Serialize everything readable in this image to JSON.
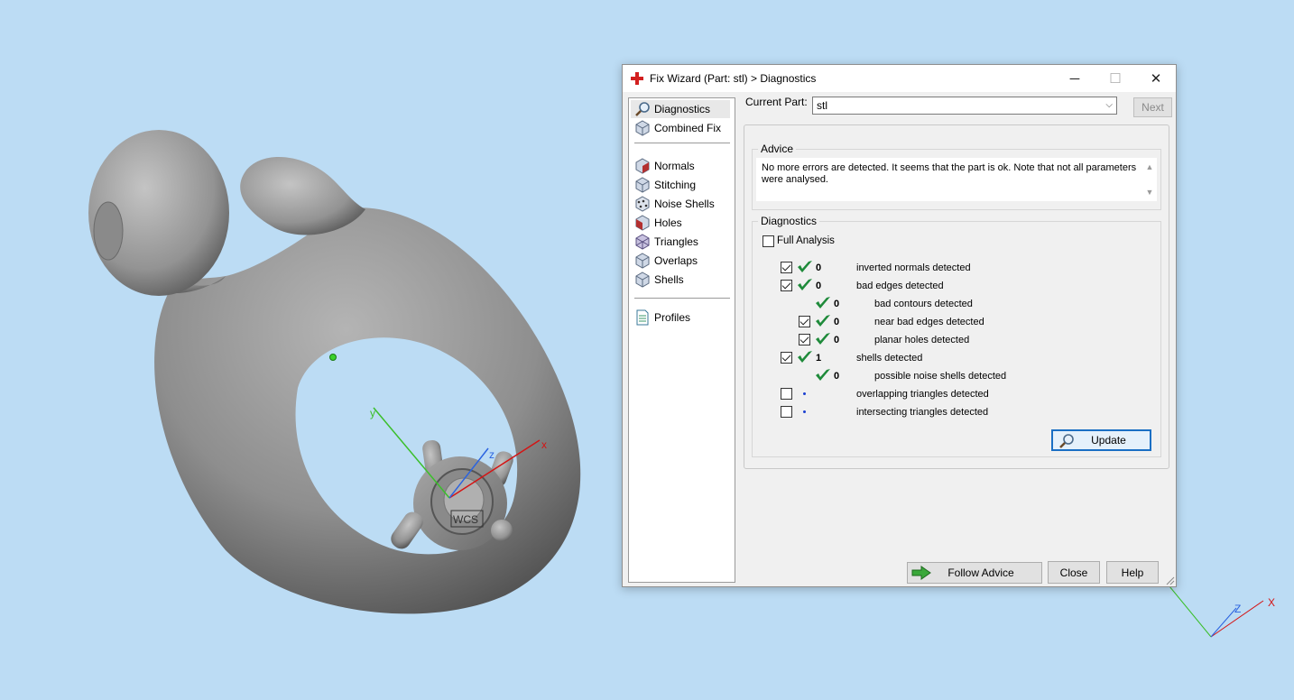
{
  "viewport": {
    "wcs_label": "WCS",
    "axis_x": "x",
    "axis_y": "y",
    "axis_z": "z",
    "mini_axis_x": "X",
    "mini_axis_z": "Z"
  },
  "dialog": {
    "title": "Fix Wizard (Part: stl) > Diagnostics",
    "window_buttons": {
      "minimize": "─",
      "maximize": "☐",
      "close": "✕"
    },
    "nav": {
      "items": [
        {
          "label": "Diagnostics",
          "icon": "magnifier-icon"
        },
        {
          "label": "Combined Fix",
          "icon": "cube-icon"
        },
        {
          "label": "Normals",
          "icon": "normals-cube-icon"
        },
        {
          "label": "Stitching",
          "icon": "stitching-cube-icon"
        },
        {
          "label": "Noise Shells",
          "icon": "noise-shells-icon"
        },
        {
          "label": "Holes",
          "icon": "holes-cube-icon"
        },
        {
          "label": "Triangles",
          "icon": "triangles-cube-icon"
        },
        {
          "label": "Overlaps",
          "icon": "overlaps-cube-icon"
        },
        {
          "label": "Shells",
          "icon": "shells-cube-icon"
        },
        {
          "label": "Profiles",
          "icon": "document-icon"
        }
      ]
    },
    "current_part_label": "Current Part:",
    "current_part_value": "stl",
    "next_label": "Next",
    "advice": {
      "title": "Advice",
      "text": "No more errors are detected. It seems that the part is ok. Note that not all parameters were analysed."
    },
    "diagnostics": {
      "title": "Diagnostics",
      "full_analysis_label": "Full Analysis",
      "full_analysis_checked": false,
      "rows": [
        {
          "checkbox": true,
          "checked": true,
          "status": "ok",
          "count": "0",
          "label": "inverted normals detected",
          "indent": 0
        },
        {
          "checkbox": true,
          "checked": true,
          "status": "ok",
          "count": "0",
          "label": "bad edges detected",
          "indent": 0
        },
        {
          "checkbox": false,
          "checked": false,
          "status": "ok",
          "count": "0",
          "label": "bad contours detected",
          "indent": 1
        },
        {
          "checkbox": true,
          "checked": true,
          "status": "ok",
          "count": "0",
          "label": "near bad edges detected",
          "indent": 1
        },
        {
          "checkbox": true,
          "checked": true,
          "status": "ok",
          "count": "0",
          "label": "planar holes detected",
          "indent": 1
        },
        {
          "checkbox": true,
          "checked": true,
          "status": "ok",
          "count": "1",
          "label": "shells detected",
          "indent": 0
        },
        {
          "checkbox": false,
          "checked": false,
          "status": "ok",
          "count": "0",
          "label": "possible noise shells detected",
          "indent": 1
        },
        {
          "checkbox": true,
          "checked": false,
          "status": "unknown",
          "count": "",
          "label": "overlapping triangles detected",
          "indent": 0
        },
        {
          "checkbox": true,
          "checked": false,
          "status": "unknown",
          "count": "",
          "label": "intersecting triangles detected",
          "indent": 0
        }
      ]
    },
    "update_label": "Update",
    "follow_advice_label": "Follow Advice",
    "close_label": "Close",
    "help_label": "Help"
  },
  "colors": {
    "background": "#bcdcf4",
    "ok_check": "#1e8a3a",
    "accent": "#1a6fc4",
    "model": "#8e8e8e"
  }
}
